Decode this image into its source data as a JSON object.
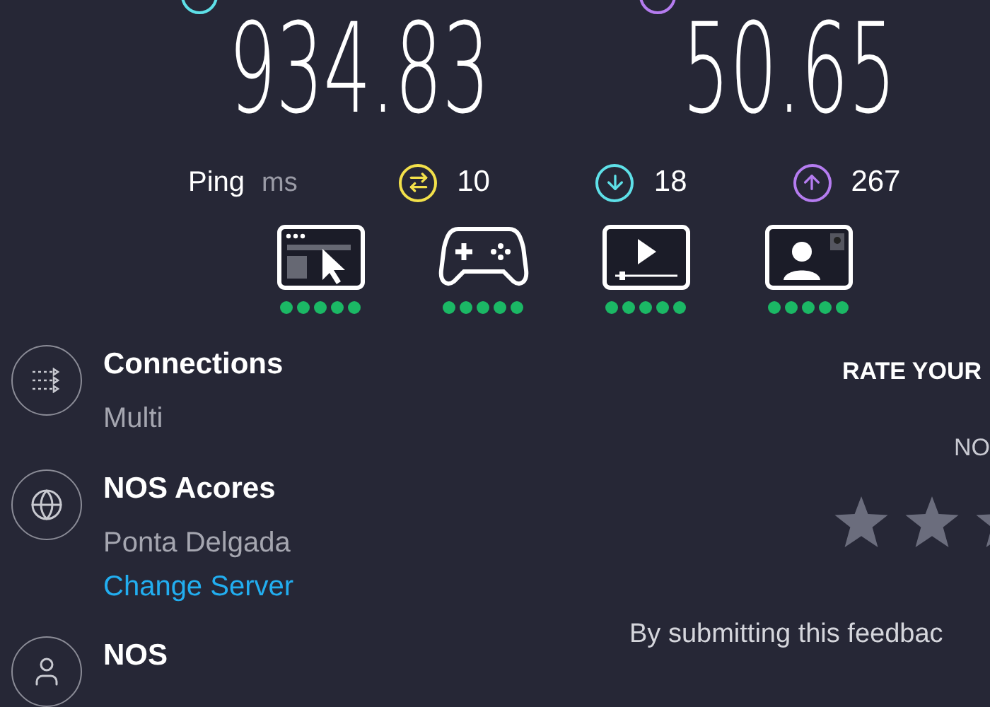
{
  "speeds": [
    {
      "value": "934.83",
      "color": "#5ee0e8"
    },
    {
      "value": "50.65",
      "color": "#b57cf0"
    }
  ],
  "ping": {
    "label": "Ping",
    "unit": "ms",
    "readings": [
      {
        "kind": "idle",
        "value": "10",
        "color": "#f2e04a"
      },
      {
        "kind": "download",
        "value": "18",
        "color": "#5ee0e8"
      },
      {
        "kind": "upload",
        "value": "267",
        "color": "#b57cf0"
      }
    ]
  },
  "quality": [
    {
      "kind": "browsing",
      "stars": 5
    },
    {
      "kind": "gaming",
      "stars": 5
    },
    {
      "kind": "streaming",
      "stars": 5
    },
    {
      "kind": "video_call",
      "stars": 5
    }
  ],
  "details": [
    {
      "kind": "connections",
      "title": "Connections",
      "subtitle": "Multi"
    },
    {
      "kind": "server",
      "title": "NOS Acores",
      "subtitle": "Ponta Delgada",
      "link": "Change Server"
    },
    {
      "kind": "provider",
      "title": "NOS"
    }
  ],
  "rating": {
    "title": "RATE YOUR",
    "provider": "NO",
    "note": "By submitting this feedbac"
  }
}
